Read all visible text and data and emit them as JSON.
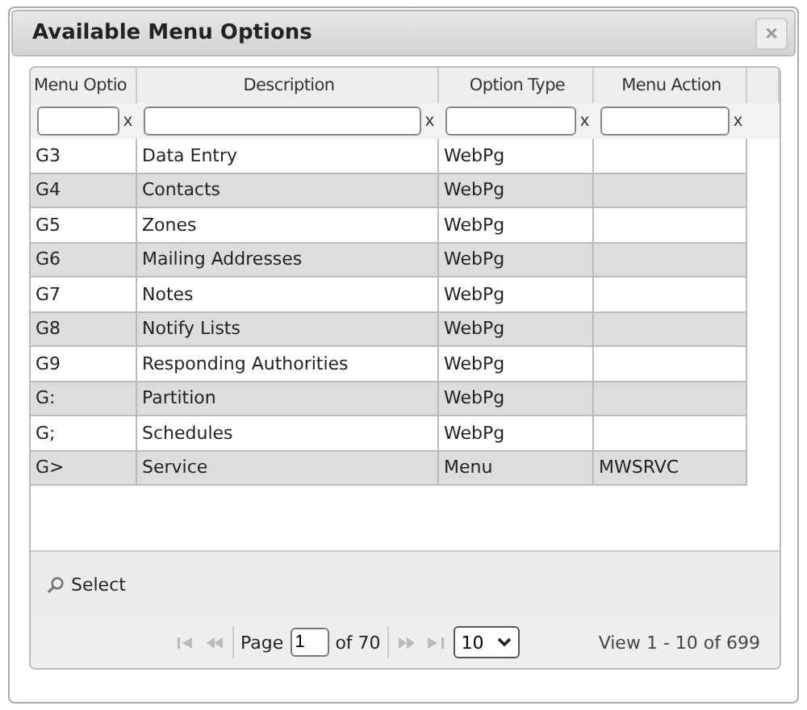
{
  "dialog": {
    "title": "Available Menu Options",
    "close": "×"
  },
  "columns": [
    "Menu Optio",
    "Description",
    "Option Type",
    "Menu Action"
  ],
  "filters": [
    {
      "clear": "x"
    },
    {
      "clear": "x"
    },
    {
      "clear": "x"
    },
    {
      "clear": "x"
    }
  ],
  "rows": [
    [
      "G3",
      "Data Entry",
      "WebPg",
      ""
    ],
    [
      "G4",
      "Contacts",
      "WebPg",
      ""
    ],
    [
      "G5",
      "Zones",
      "WebPg",
      ""
    ],
    [
      "G6",
      "Mailing Addresses",
      "WebPg",
      ""
    ],
    [
      "G7",
      "Notes",
      "WebPg",
      ""
    ],
    [
      "G8",
      "Notify Lists",
      "WebPg",
      ""
    ],
    [
      "G9",
      "Responding Authorities",
      "WebPg",
      ""
    ],
    [
      "G:",
      "Partition",
      "WebPg",
      ""
    ],
    [
      "G;",
      "Schedules",
      "WebPg",
      ""
    ],
    [
      "G>",
      "Service",
      "Menu",
      "MWSRVC"
    ]
  ],
  "select_button": "Select",
  "pager": {
    "page_label": "Page",
    "page": "1",
    "of": "of 70",
    "page_size": "10",
    "view": "View 1 - 10 of 699"
  }
}
